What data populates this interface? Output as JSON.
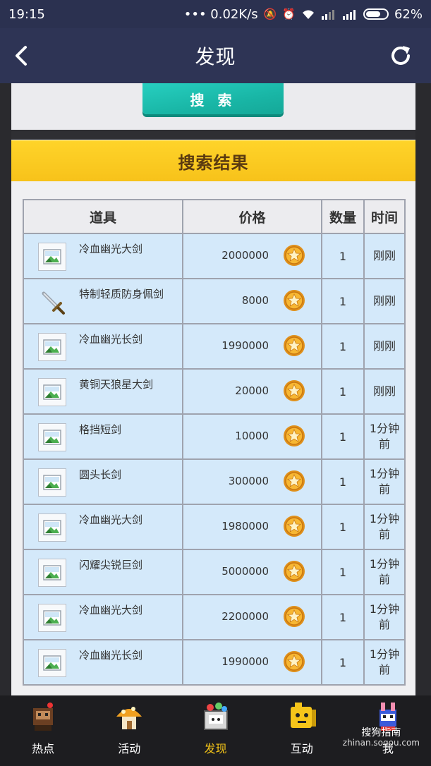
{
  "status_bar": {
    "time": "19:15",
    "network": "••• 0.02K/s",
    "battery": "62%"
  },
  "nav": {
    "title": "发现",
    "back_icon": "back-arrow-icon",
    "refresh_icon": "refresh-icon"
  },
  "search": {
    "button_label": "搜 索"
  },
  "results": {
    "title": "搜索结果",
    "headers": {
      "item": "道具",
      "price": "价格",
      "qty": "数量",
      "time": "时间"
    },
    "rows": [
      {
        "name": "冷血幽光大剑",
        "price": "2000000",
        "qty": "1",
        "time": "刚刚",
        "icon": "broken-image-icon"
      },
      {
        "name": "特制轻质防身佩剑",
        "price": "8000",
        "qty": "1",
        "time": "刚刚",
        "icon": "sword-icon"
      },
      {
        "name": "冷血幽光长剑",
        "price": "1990000",
        "qty": "1",
        "time": "刚刚",
        "icon": "broken-image-icon"
      },
      {
        "name": "黄铜天狼星大剑",
        "price": "20000",
        "qty": "1",
        "time": "刚刚",
        "icon": "broken-image-icon"
      },
      {
        "name": "格挡短剑",
        "price": "10000",
        "qty": "1",
        "time": "1分钟前",
        "icon": "broken-image-icon"
      },
      {
        "name": "圆头长剑",
        "price": "300000",
        "qty": "1",
        "time": "1分钟前",
        "icon": "broken-image-icon"
      },
      {
        "name": "冷血幽光大剑",
        "price": "1980000",
        "qty": "1",
        "time": "1分钟前",
        "icon": "broken-image-icon"
      },
      {
        "name": "闪耀尖锐巨剑",
        "price": "5000000",
        "qty": "1",
        "time": "1分钟前",
        "icon": "broken-image-icon"
      },
      {
        "name": "冷血幽光大剑",
        "price": "2200000",
        "qty": "1",
        "time": "1分钟前",
        "icon": "broken-image-icon"
      },
      {
        "name": "冷血幽光长剑",
        "price": "1990000",
        "qty": "1",
        "time": "1分钟前",
        "icon": "broken-image-icon"
      }
    ]
  },
  "tabs": [
    {
      "label": "热点",
      "icon": "hotspot-character-icon",
      "active": false
    },
    {
      "label": "活动",
      "icon": "mushroom-house-icon",
      "active": false
    },
    {
      "label": "发现",
      "icon": "discover-cart-icon",
      "active": true
    },
    {
      "label": "互动",
      "icon": "yellow-cube-icon",
      "active": false
    },
    {
      "label": "我",
      "icon": "profile-character-icon",
      "active": false
    }
  ],
  "watermark": {
    "main": "搜狗指南",
    "sub": "zhinan.sogou.com"
  },
  "colors": {
    "navbar": "#2e3455",
    "search_button": "#1fbfb0",
    "banner": "#ffcf25",
    "row_bg": "#d4e9fa",
    "active_tab": "#f5c518"
  }
}
